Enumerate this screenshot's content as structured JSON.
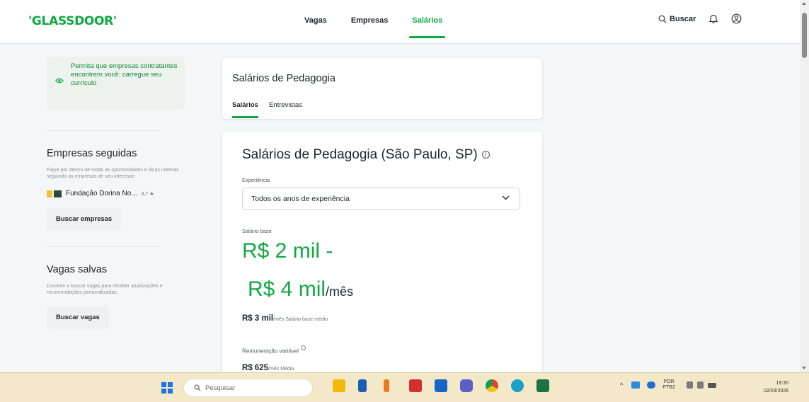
{
  "header": {
    "logo": "'GLASSDOOR'",
    "nav": [
      "Vagas",
      "Empresas",
      "Salários"
    ],
    "active_nav": "Salários",
    "search_label": "Buscar"
  },
  "sidebar": {
    "resume_prompt": "Permita que empresas contratantes encontrem você: carregue seu currículo",
    "followed": {
      "title": "Empresas seguidas",
      "description": "Fique por dentro de todas as oportunidades e dicas internas seguindo as empresas de seu interesse.",
      "company_name": "Fundação Dorina No...",
      "company_rating": "3,7 ★",
      "button": "Buscar empresas"
    },
    "saved_jobs": {
      "title": "Vagas salvas",
      "description": "Comece a buscar vagas para receber atualizações e recomendações personalizadas.",
      "button": "Buscar vagas"
    }
  },
  "page_header": {
    "title": "Salários de Pedagogia",
    "tabs": [
      "Salários",
      "Entrevistas"
    ],
    "active_tab": "Salários"
  },
  "salary_card": {
    "title": "Salários de Pedagogia (São Paulo, SP)",
    "experience_label": "Experiência",
    "experience_value": "Todos os anos de experiência",
    "base_label": "Salário base",
    "range_line1": "R$ 2 mil -",
    "range_line2": "R$ 4 mil",
    "per_month": "/mês",
    "avg_value": "R$ 3 mil",
    "avg_suffix": "/mês Salário base médio",
    "variable_label": "Remuneração variável",
    "variable_value": "R$ 625",
    "variable_suffix": "/mês Média"
  },
  "taskbar": {
    "search_placeholder": "Pesquisar",
    "lang_top": "POR",
    "lang_bottom": "PTB2",
    "time": "19:30",
    "date": "02/03/2026"
  },
  "colors": {
    "brand_green": "#0caa41",
    "taskbar": "#f3e9c9"
  }
}
